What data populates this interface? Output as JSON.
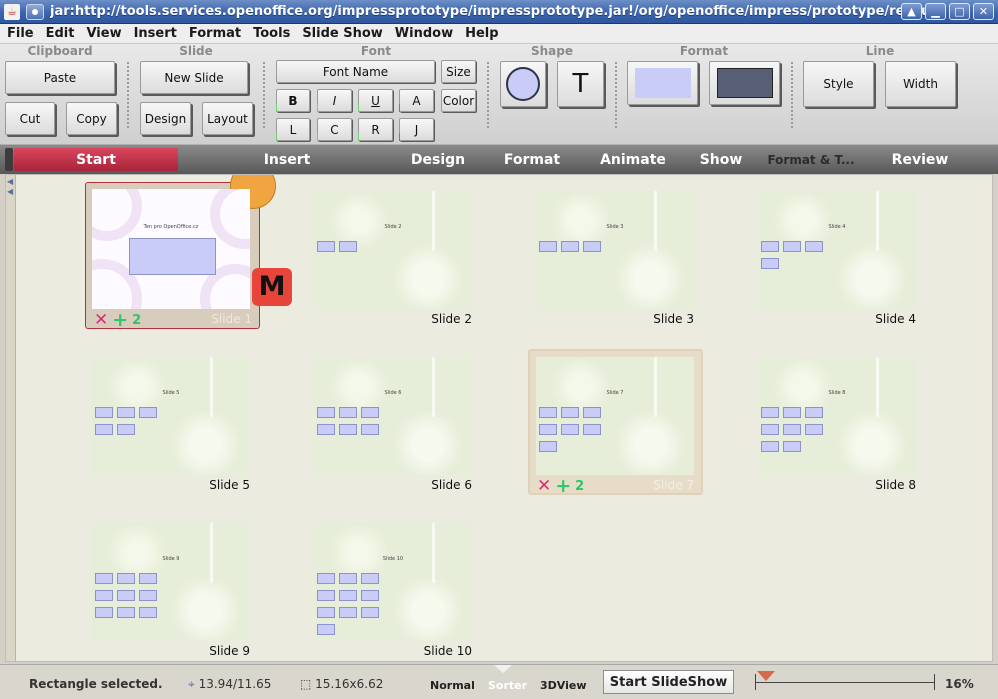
{
  "window": {
    "title": "jar:http://tools.services.openoffice.org/impressprototype/impressprototype.jar!/org/openoffice/impress/prototype/resource"
  },
  "menu": [
    "File",
    "Edit",
    "View",
    "Insert",
    "Format",
    "Tools",
    "Slide Show",
    "Window",
    "Help"
  ],
  "ribbon": {
    "groups": {
      "clipboard": "Clipboard",
      "slide": "Slide",
      "font": "Font",
      "shape": "Shape",
      "format": "Format",
      "line": "Line"
    },
    "clipboard": {
      "paste": "Paste",
      "cut": "Cut",
      "copy": "Copy"
    },
    "slide": {
      "new_slide": "New Slide",
      "design": "Design",
      "layout": "Layout"
    },
    "font": {
      "name": "Font Name",
      "size": "Size",
      "bold": "B",
      "italic": "I",
      "underline": "U",
      "shadow": "A",
      "color": "Color",
      "left": "L",
      "center": "C",
      "right": "R",
      "justify": "J"
    },
    "shape": {
      "text": "T"
    },
    "line": {
      "style": "Style",
      "width": "Width"
    }
  },
  "tabs": [
    "Start",
    "Insert",
    "Design",
    "Format",
    "Animate",
    "Show",
    "Format & T...",
    "Review"
  ],
  "slides": [
    {
      "label": "Slide 1",
      "title": "Ten pro OpenOffice.cz"
    },
    {
      "label": "Slide 2",
      "title": "Slide 2"
    },
    {
      "label": "Slide 3",
      "title": "Slide 3"
    },
    {
      "label": "Slide 4",
      "title": "Slide 4"
    },
    {
      "label": "Slide 5",
      "title": "Slide 5"
    },
    {
      "label": "Slide 6",
      "title": "Slide 6"
    },
    {
      "label": "Slide 7",
      "title": "Slide 7"
    },
    {
      "label": "Slide 8",
      "title": "Slide 8"
    },
    {
      "label": "Slide 9",
      "title": "Slide 9"
    },
    {
      "label": "Slide 10",
      "title": "Slide 10"
    }
  ],
  "slide_badges": {
    "master": "M",
    "count_1": "2",
    "count_7": "2"
  },
  "status": {
    "message": "Rectangle selected.",
    "position": "13.94/11.65",
    "size": "15.16x6.62",
    "views": [
      "Normal",
      "Sorter",
      "3DView"
    ],
    "start_slideshow": "Start SlideShow",
    "zoom": "16%"
  }
}
